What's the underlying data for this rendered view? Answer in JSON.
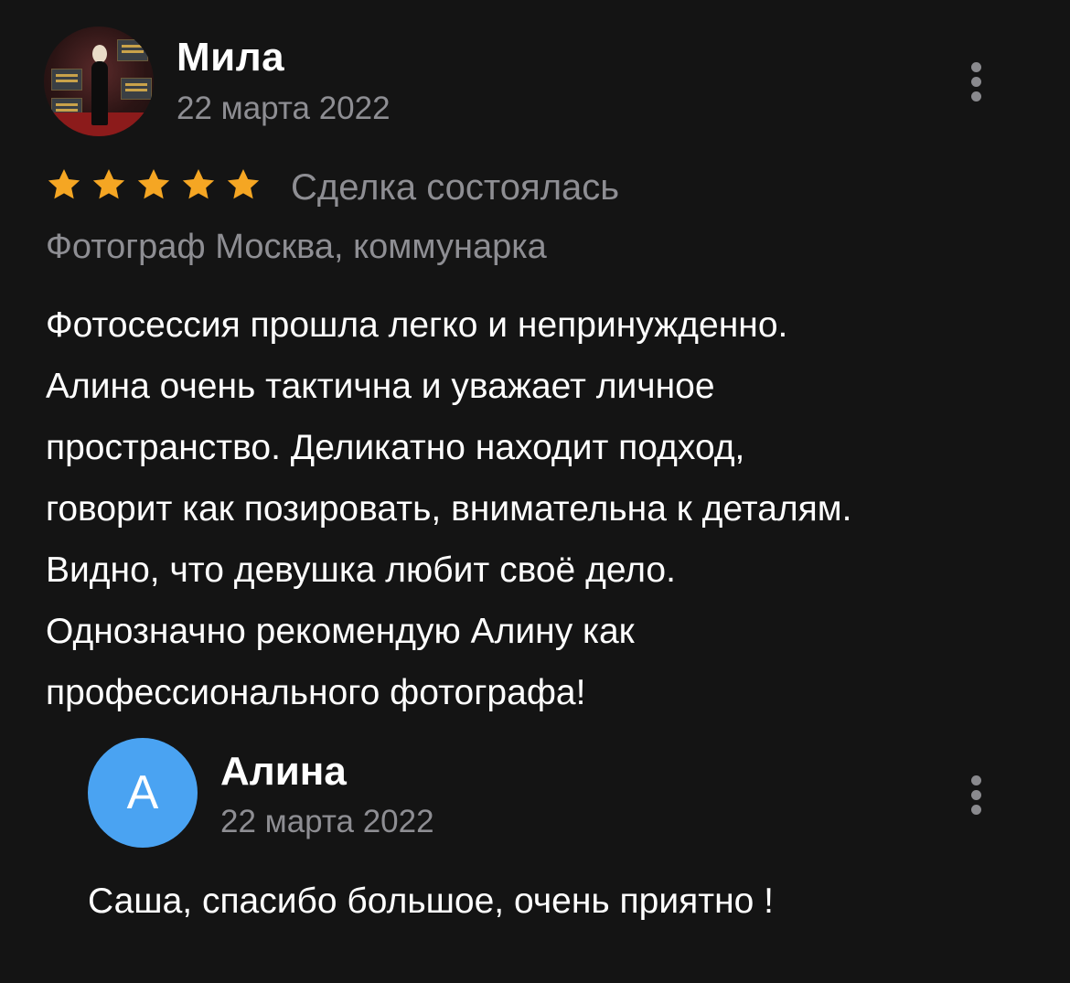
{
  "review": {
    "author": "Мила",
    "date": "22 марта 2022",
    "rating": 5,
    "rating_max": 5,
    "star_color": "#f5a623",
    "deal_status": "Сделка состоялась",
    "service": "Фотограф Москва, коммунарка",
    "text_lines": [
      "Фотосессия прошла легко и непринужденно.",
      "Алина очень тактична и уважает личное",
      "пространство. Деликатно находит подход,",
      "говорит как позировать, внимательна к деталям.",
      "Видно, что девушка любит своё дело.",
      "Однозначно рекомендую Алину как",
      "профессионального фотографа!"
    ],
    "avatar_icon": "user-photo"
  },
  "reply": {
    "avatar_letter": "А",
    "avatar_color": "#4aa3f2",
    "author": "Алина",
    "date": "22 марта 2022",
    "text": "Саша, спасибо большое, очень приятно !"
  },
  "icons": {
    "more": "more-vertical-icon",
    "star": "star-icon"
  }
}
